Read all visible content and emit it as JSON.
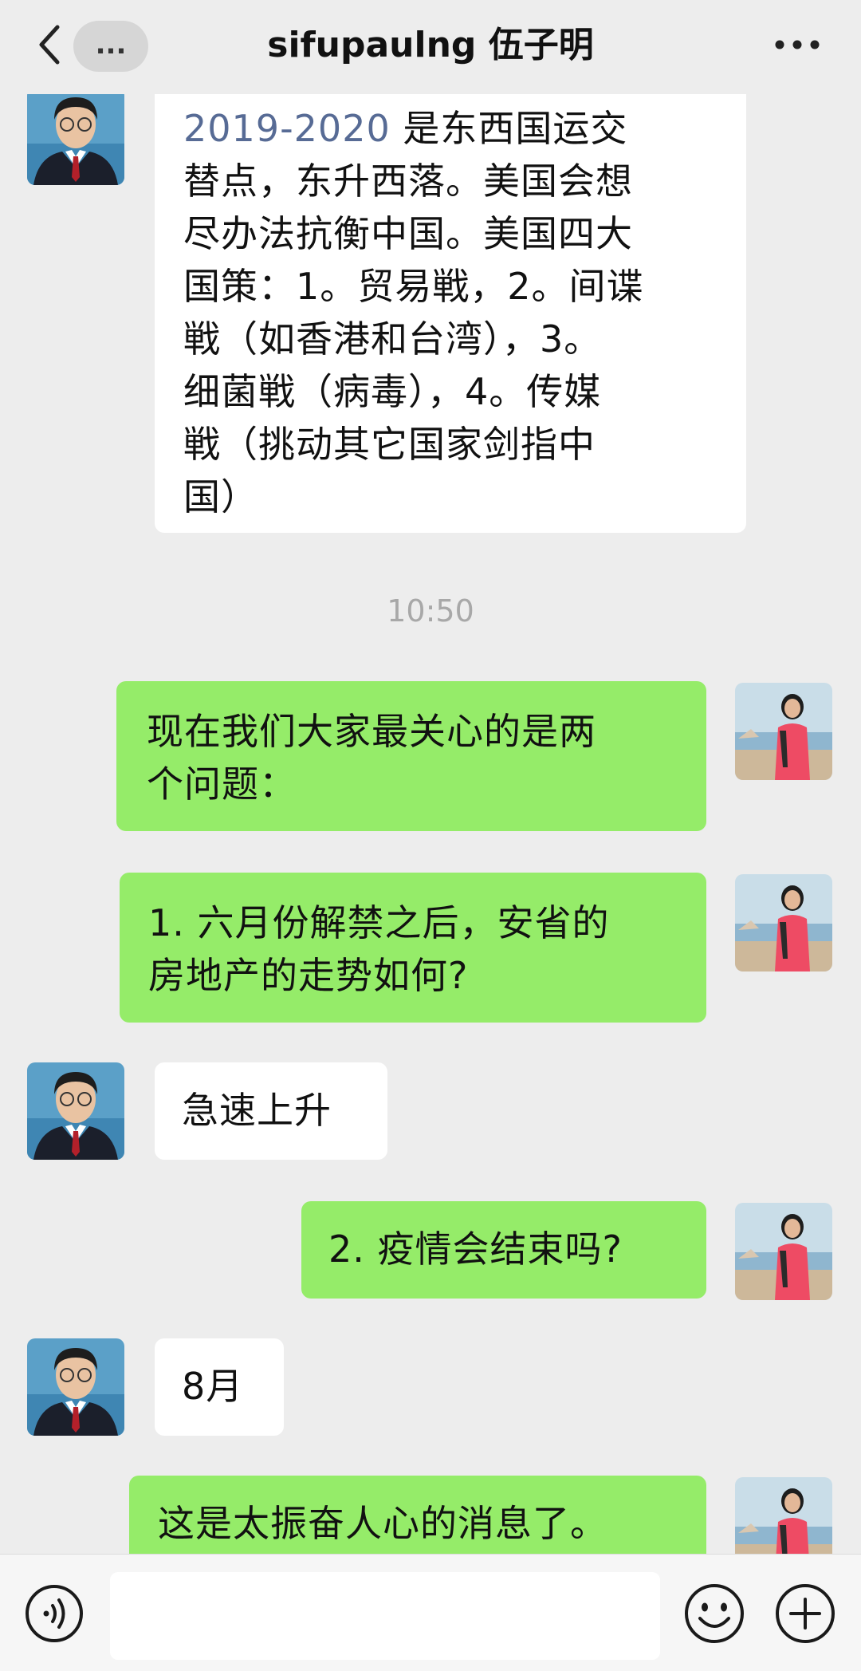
{
  "header": {
    "title": "sifupaulng 伍子明",
    "more_label": "...",
    "back_icon": "chevron-left-icon",
    "menu_icon": "more-horizontal-icon"
  },
  "colors": {
    "background": "#ededed",
    "sent_bubble": "#95ec69",
    "received_bubble": "#ffffff",
    "link_text": "#576b95",
    "timestamp": "#a8a8a8"
  },
  "messages": [
    {
      "sender": "sifupaulng",
      "year_highlight": "2019-2020",
      "text": " 是东西国运交\n替点，东升西落。美国会想\n尽办法抗衡中国。美国四大\n国策：1。贸易戦，2。间谍\n戦（如香港和台湾），3。\n细菌戦（病毒），4。传媒\n戦（挑动其它国家剑指中\n国）"
    },
    {
      "sender": "me",
      "text": "现在我们大家最关心的是两\n个问题："
    },
    {
      "sender": "me",
      "text": "1. 六月份解禁之后，安省的\n房地产的走势如何?"
    },
    {
      "sender": "sifupaulng",
      "text": "急速上升"
    },
    {
      "sender": "me",
      "text": "2. 疫情会结束吗?"
    },
    {
      "sender": "sifupaulng",
      "text": "8月"
    },
    {
      "sender": "me",
      "text": "这是太振奋人心的消息了。"
    }
  ],
  "timestamp": "10:50",
  "input": {
    "value": "",
    "voice_icon": "voice-icon",
    "emoji_icon": "emoji-icon",
    "plus_icon": "plus-icon"
  }
}
